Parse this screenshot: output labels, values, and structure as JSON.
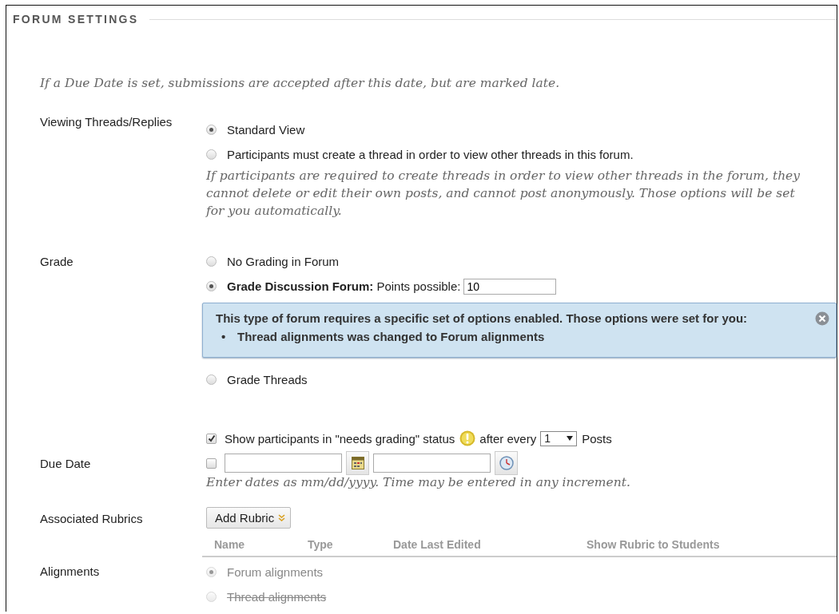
{
  "section_title": "FORUM SETTINGS",
  "note": "If a Due Date is set, submissions are accepted after this date, but are marked late.",
  "viewing": {
    "label": "Viewing Threads/Replies",
    "options": [
      {
        "text": "Standard View",
        "selected": true
      },
      {
        "text": "Participants must create a thread in order to view other threads in this forum.",
        "selected": false
      }
    ],
    "help": "If participants are required to create threads in order to view other threads in the forum, they cannot delete or edit their own posts, and cannot post anonymously. Those options will be set for you automatically."
  },
  "grade": {
    "label": "Grade",
    "options": [
      {
        "kind": "plain",
        "text": "No Grading in Forum",
        "selected": false
      },
      {
        "kind": "points",
        "text": "Grade Discussion Forum:",
        "points_label": "Points possible:",
        "points_value": "10",
        "selected": true,
        "alert": {
          "message": "This type of forum requires a specific set of options enabled. Those options were set for you:",
          "marker": "•",
          "items": [
            "Thread alignments was changed to Forum alignments"
          ]
        }
      },
      {
        "kind": "plain",
        "text": "Grade Threads",
        "selected": false
      }
    ]
  },
  "needs_grading": {
    "checked": true,
    "text_before": "Show participants in \"needs grading\" status",
    "text_after": "after every",
    "count": "1",
    "text_end": "Posts"
  },
  "due_date": {
    "label": "Due Date",
    "checked": false,
    "help": "Enter dates as mm/dd/yyyy. Time may be entered in any increment."
  },
  "rubrics": {
    "label": "Associated Rubrics",
    "button": "Add Rubric",
    "columns": [
      "Name",
      "Type",
      "Date Last Edited",
      "Show Rubric to Students"
    ]
  },
  "alignments": {
    "label": "Alignments",
    "options": [
      {
        "text": "Forum alignments",
        "selected": true,
        "disabled": true,
        "struck": false
      },
      {
        "text": "Thread alignments",
        "selected": false,
        "disabled": true,
        "struck": true
      }
    ]
  }
}
